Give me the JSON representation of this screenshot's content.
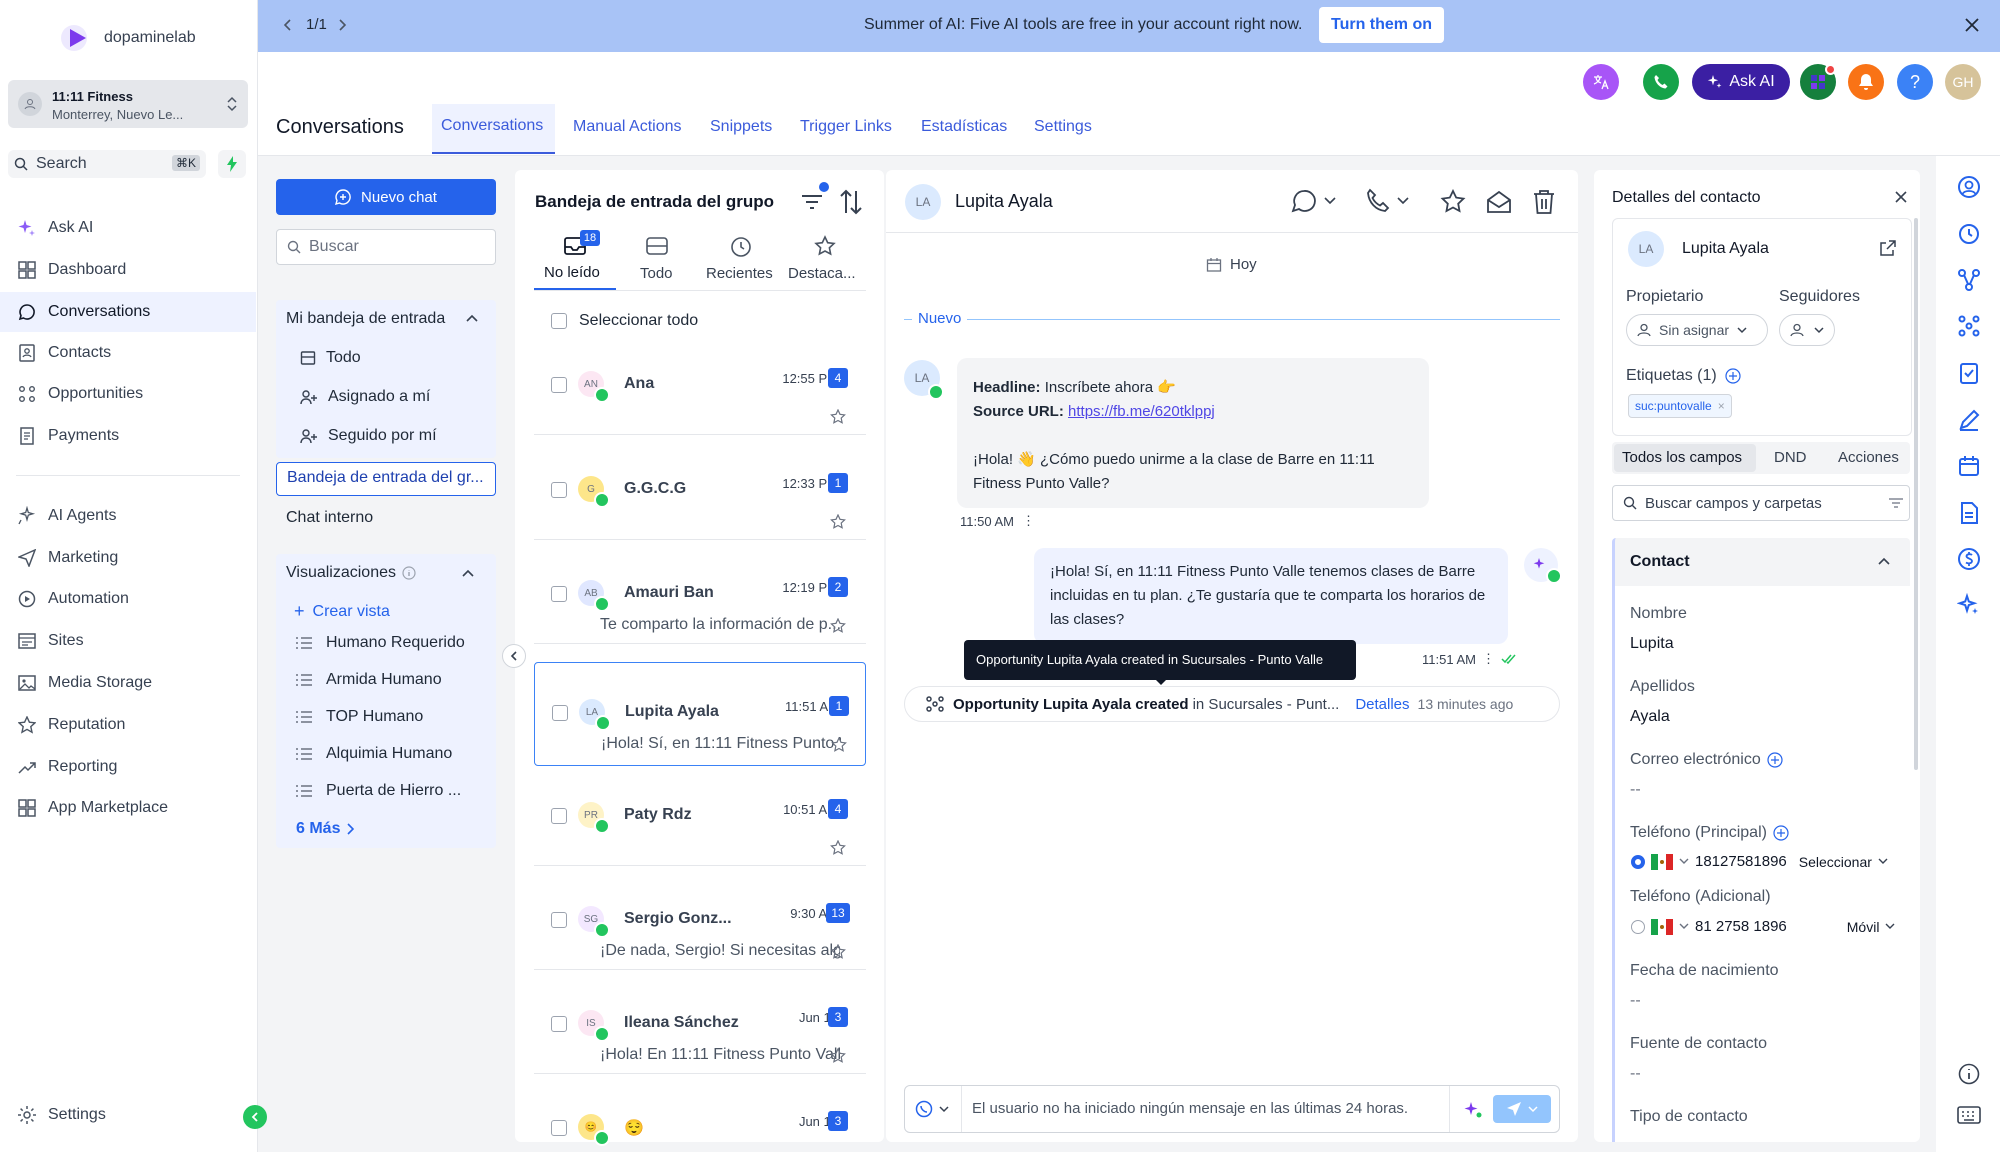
{
  "sidebar": {
    "brand": "dopaminelab",
    "location_name": "11:11 Fitness",
    "location_sub": "Monterrey, Nuevo Le...",
    "search_label": "Search",
    "search_shortcut": "⌘K",
    "nav": [
      {
        "label": "Ask AI",
        "icon": "sparkle-icon"
      },
      {
        "label": "Dashboard",
        "icon": "grid-icon"
      },
      {
        "label": "Conversations",
        "icon": "chat-icon"
      },
      {
        "label": "Contacts",
        "icon": "contacts-icon"
      },
      {
        "label": "Opportunities",
        "icon": "opportunities-icon"
      },
      {
        "label": "Payments",
        "icon": "payments-icon"
      },
      {
        "label": "AI Agents",
        "icon": "ai-agents-icon"
      },
      {
        "label": "Marketing",
        "icon": "send-icon"
      },
      {
        "label": "Automation",
        "icon": "automation-icon"
      },
      {
        "label": "Sites",
        "icon": "sites-icon"
      },
      {
        "label": "Media Storage",
        "icon": "image-icon"
      },
      {
        "label": "Reputation",
        "icon": "star-icon"
      },
      {
        "label": "Reporting",
        "icon": "trend-icon"
      },
      {
        "label": "App Marketplace",
        "icon": "apps-icon"
      }
    ],
    "settings_label": "Settings"
  },
  "banner": {
    "pager": "1/1",
    "message": "Summer of AI: Five AI tools are free in your account right now.",
    "cta": "Turn them on"
  },
  "header": {
    "title": "Conversations",
    "tabs": [
      "Conversations",
      "Manual Actions",
      "Snippets",
      "Trigger Links",
      "Estadísticas",
      "Settings"
    ],
    "ask_ai": "Ask AI",
    "help": "?",
    "user_initials": "GH"
  },
  "inbox_nav": {
    "new_chat": "Nuevo chat",
    "search_placeholder": "Buscar",
    "my_inbox": "Mi bandeja de entrada",
    "sub_items": [
      "Todo",
      "Asignado a mí",
      "Seguido por mí"
    ],
    "group_inbox": "Bandeja de entrada del gr...",
    "internal_chat": "Chat interno",
    "views_title": "Visualizaciones",
    "create_view": "Crear vista",
    "views": [
      "Humano Requerido",
      "Armida Humano",
      "TOP Humano",
      "Alquimia Humano",
      "Puerta de Hierro ..."
    ],
    "more": "6 Más"
  },
  "conv_list": {
    "title": "Bandeja de entrada del grupo",
    "tabs": [
      {
        "label": "No leído",
        "icon": "inbox-icon",
        "count": "18"
      },
      {
        "label": "Todo",
        "icon": "tray-icon"
      },
      {
        "label": "Recientes",
        "icon": "clock-icon"
      },
      {
        "label": "Destaca...",
        "icon": "star-icon"
      }
    ],
    "select_all": "Seleccionar todo",
    "items": [
      {
        "initials": "AN",
        "name": "Ana",
        "time": "12:55 PM",
        "count": "4",
        "preview": "",
        "color": "#fce7f3"
      },
      {
        "initials": "G",
        "name": "G.G.C.G",
        "time": "12:33 PM",
        "count": "1",
        "preview": "",
        "color": "#fde68a"
      },
      {
        "initials": "AB",
        "name": "Amauri Ban",
        "time": "12:19 PM",
        "count": "2",
        "preview": "Te comparto la información de p...",
        "color": "#e0e7ff"
      },
      {
        "initials": "LA",
        "name": "Lupita Ayala",
        "time": "11:51 AM",
        "count": "1",
        "preview": "¡Hola! Sí, en 11:11 Fitness Punto V...",
        "color": "#dbeafe"
      },
      {
        "initials": "PR",
        "name": "Paty Rdz",
        "time": "10:51 AM",
        "count": "4",
        "preview": "",
        "color": "#fef3c7"
      },
      {
        "initials": "SG",
        "name": "Sergio Gonz...",
        "time": "9:30 AM",
        "count": "13",
        "preview": "¡De nada, Sergio! Si necesitas alg...",
        "color": "#f3e8ff"
      },
      {
        "initials": "IS",
        "name": "Ileana Sánchez",
        "time": "Jun 14",
        "count": "3",
        "preview": "¡Hola! En 11:11 Fitness Punto Valle ...",
        "color": "#fce7f3"
      },
      {
        "initials": "😊",
        "name": "😌",
        "time": "Jun 14",
        "count": "3",
        "preview": "",
        "color": "#fde68a"
      }
    ]
  },
  "chat": {
    "contact_initials": "LA",
    "contact_name": "Lupita Ayala",
    "date_chip": "Hoy",
    "new_divider": "Nuevo",
    "incoming": {
      "headline_label": "Headline:",
      "headline_value": "Inscríbete ahora 👉",
      "source_label": "Source URL:",
      "source_url": "https://fb.me/620tklppj",
      "text": "¡Hola! 👋 ¿Cómo puedo unirme a la clase de Barre en 11:11 Fitness Punto Valle?",
      "time": "11:50 AM"
    },
    "outgoing": {
      "text": "¡Hola! Sí, en 11:11 Fitness Punto Valle tenemos clases de Barre incluidas en tu plan. ¿Te gustaría que te comparta los horarios de las clases?",
      "time": "11:51 AM"
    },
    "tooltip": "Opportunity Lupita Ayala created in Sucursales - Punto Valle",
    "activity": {
      "bold": "Opportunity Lupita Ayala created",
      "rest": " in Sucursales - Punt...",
      "link": "Detalles",
      "ago": "13 minutes ago"
    },
    "composer_placeholder": "El usuario no ha iniciado ningún mensaje en las últimas 24 horas."
  },
  "contact_panel": {
    "title": "Detalles del contacto",
    "initials": "LA",
    "name": "Lupita Ayala",
    "owner_label": "Propietario",
    "owner_value": "Sin asignar",
    "followers_label": "Seguidores",
    "tags_label": "Etiquetas (1)",
    "tag": "suc:puntovalle",
    "tabs": [
      "Todos los campos",
      "DND",
      "Acciones"
    ],
    "search_placeholder": "Buscar campos y carpetas",
    "section": "Contact",
    "fields": {
      "first_name_label": "Nombre",
      "first_name": "Lupita",
      "last_name_label": "Apellidos",
      "last_name": "Ayala",
      "email_label": "Correo electrónico",
      "email": "--",
      "phone_main_label": "Teléfono (Principal)",
      "phone_main": "18127581896",
      "phone_main_type": "Seleccionar",
      "phone_alt_label": "Teléfono (Adicional)",
      "phone_alt": "81 2758 1896",
      "phone_alt_type": "Móvil",
      "dob_label": "Fecha de nacimiento",
      "dob": "--",
      "source_label": "Fuente de contacto",
      "source": "--",
      "type_label": "Tipo de contacto"
    }
  },
  "colors": {
    "primary": "#2563eb",
    "banner": "#a8c3f6",
    "ask_ai": "#3b1fa3",
    "phone_green": "#16a34a",
    "bell_orange": "#f97316",
    "translate_purple": "#a855f7"
  }
}
